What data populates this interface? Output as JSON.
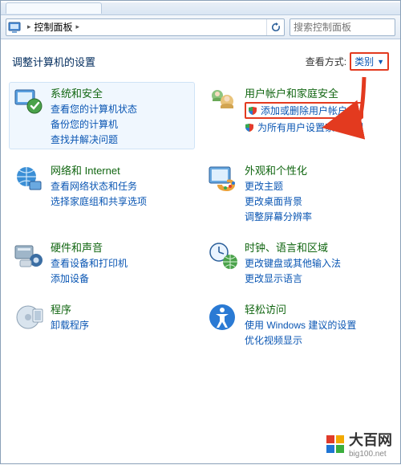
{
  "window": {
    "title_tab": ""
  },
  "addr": {
    "root_label": "控制面板",
    "nav_chevron": "▸",
    "refresh_label": "刷新"
  },
  "search": {
    "placeholder": "搜索控制面板"
  },
  "header": {
    "title": "调整计算机的设置",
    "view_by_label": "查看方式:",
    "view_by_value": "类别"
  },
  "categories": {
    "left": [
      {
        "title": "系统和安全",
        "links": [
          "查看您的计算机状态",
          "备份您的计算机",
          "查找并解决问题"
        ],
        "shield": [
          false,
          false,
          false
        ]
      },
      {
        "title": "网络和 Internet",
        "links": [
          "查看网络状态和任务",
          "选择家庭组和共享选项"
        ],
        "shield": [
          false,
          false
        ]
      },
      {
        "title": "硬件和声音",
        "links": [
          "查看设备和打印机",
          "添加设备"
        ],
        "shield": [
          false,
          false
        ]
      },
      {
        "title": "程序",
        "links": [
          "卸载程序"
        ],
        "shield": [
          false
        ]
      }
    ],
    "right": [
      {
        "title": "用户帐户和家庭安全",
        "links": [
          "添加或删除用户帐户",
          "为所有用户设置家长控制"
        ],
        "shield": [
          true,
          true
        ],
        "highlight_index": 0
      },
      {
        "title": "外观和个性化",
        "links": [
          "更改主题",
          "更改桌面背景",
          "调整屏幕分辨率"
        ],
        "shield": [
          false,
          false,
          false
        ]
      },
      {
        "title": "时钟、语言和区域",
        "links": [
          "更改键盘或其他输入法",
          "更改显示语言"
        ],
        "shield": [
          false,
          false
        ]
      },
      {
        "title": "轻松访问",
        "links": [
          "使用 Windows 建议的设置",
          "优化视频显示"
        ],
        "shield": [
          false,
          false
        ]
      }
    ]
  },
  "watermark": {
    "brand": "大百网",
    "domain": "big100.net"
  },
  "colors": {
    "accent_blue": "#0a56b3",
    "heading_green": "#116611",
    "annotation_red": "#e33a1f"
  }
}
